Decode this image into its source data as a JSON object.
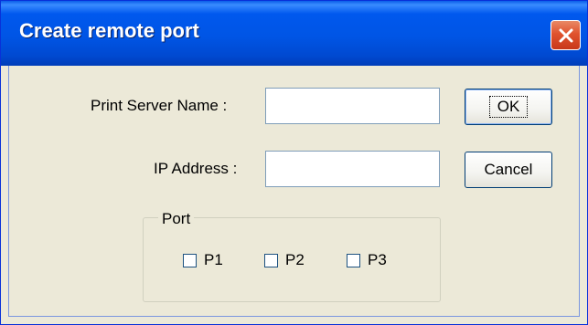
{
  "window": {
    "title": "Create remote port"
  },
  "form": {
    "print_server_label": "Print Server Name :",
    "print_server_value": "",
    "ip_label": "IP Address :",
    "ip_value": ""
  },
  "buttons": {
    "ok": "OK",
    "cancel": "Cancel"
  },
  "port_group": {
    "legend": "Port",
    "options": [
      {
        "label": "P1",
        "checked": false
      },
      {
        "label": "P2",
        "checked": false
      },
      {
        "label": "P3",
        "checked": false
      }
    ]
  },
  "colors": {
    "titlebar": "#0055e5",
    "close": "#e0532e",
    "dialog_bg": "#ece9d8"
  }
}
